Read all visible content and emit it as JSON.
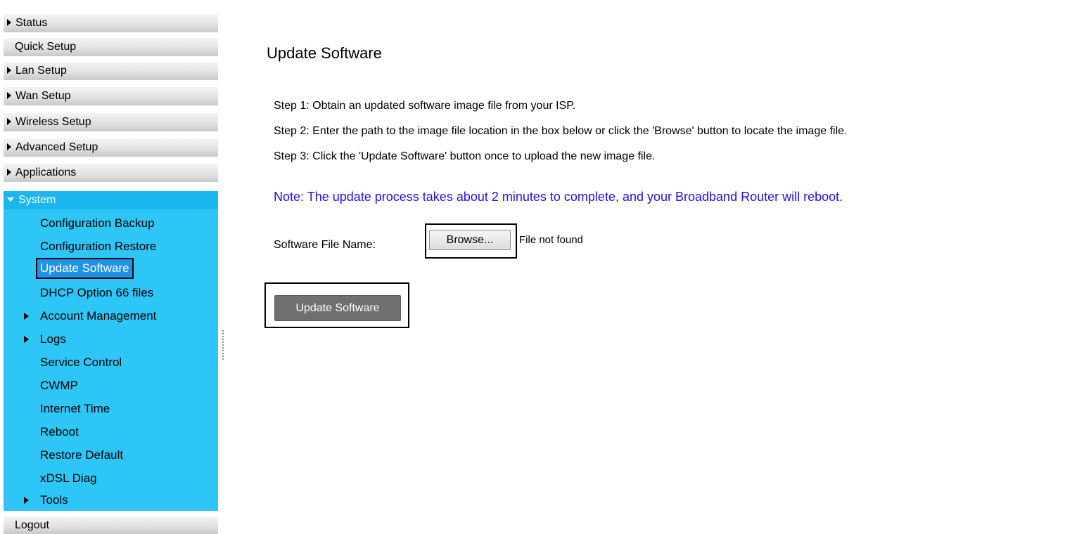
{
  "sidebar": {
    "top_items": [
      {
        "label": "Status",
        "expandable": true
      },
      {
        "label": "Quick Setup",
        "expandable": false
      },
      {
        "label": "Lan Setup",
        "expandable": true
      },
      {
        "label": "Wan Setup",
        "expandable": true
      },
      {
        "label": "Wireless Setup",
        "expandable": true
      },
      {
        "label": "Advanced Setup",
        "expandable": true
      },
      {
        "label": "Applications",
        "expandable": true
      }
    ],
    "system": {
      "label": "System",
      "items": [
        {
          "label": "Configuration Backup",
          "expandable": false
        },
        {
          "label": "Configuration Restore",
          "expandable": false
        },
        {
          "label": "Update Software",
          "expandable": false,
          "selected": true
        },
        {
          "label": "DHCP Option 66 files",
          "expandable": false
        },
        {
          "label": "Account Management",
          "expandable": true
        },
        {
          "label": "Logs",
          "expandable": true
        },
        {
          "label": "Service Control",
          "expandable": false
        },
        {
          "label": "CWMP",
          "expandable": false
        },
        {
          "label": "Internet Time",
          "expandable": false
        },
        {
          "label": "Reboot",
          "expandable": false
        },
        {
          "label": "Restore Default",
          "expandable": false
        },
        {
          "label": "xDSL Diag",
          "expandable": false
        },
        {
          "label": "Tools",
          "expandable": true
        }
      ]
    },
    "logout_label": "Logout"
  },
  "main": {
    "title": "Update Software",
    "steps": [
      "Step 1: Obtain an updated software image file from your ISP.",
      "Step 2: Enter the path to the image file location in the box below or click the 'Browse' button to locate the image file.",
      "Step 3: Click the 'Update Software' button once to upload the new image file."
    ],
    "note": "Note: The update process takes about 2 minutes to complete, and your Broadband Router will reboot.",
    "file_label": "Software File Name:",
    "browse_label": "Browse...",
    "file_status": "File not found",
    "update_button_label": "Update Software"
  },
  "colors": {
    "system_panel": "#2ec6f7",
    "system_header": "#1ab7ee",
    "selected_item": "#1f93e6",
    "note_text": "#1f10ee",
    "update_button": "#707070"
  }
}
